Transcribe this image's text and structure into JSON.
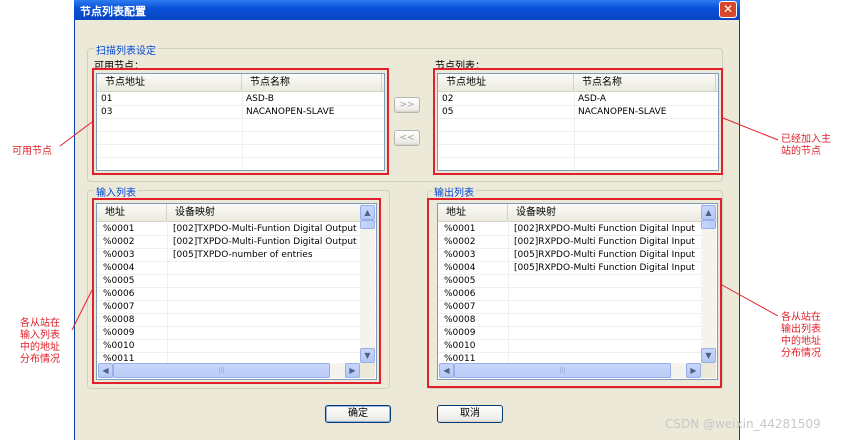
{
  "window": {
    "title": "节点列表配置",
    "close_symbol": "✕"
  },
  "scan_group": {
    "label": "扫描列表设定",
    "available": {
      "label": "可用节点：",
      "columns": [
        "节点地址",
        "节点名称"
      ],
      "rows": [
        {
          "addr": "01",
          "name": "ASD-B"
        },
        {
          "addr": "03",
          "name": "NACANOPEN-SLAVE"
        },
        {
          "addr": "",
          "name": ""
        },
        {
          "addr": "",
          "name": ""
        },
        {
          "addr": "",
          "name": ""
        },
        {
          "addr": "",
          "name": ""
        }
      ]
    },
    "scanlist": {
      "label": "节点列表：",
      "columns": [
        "节点地址",
        "节点名称"
      ],
      "rows": [
        {
          "addr": "02",
          "name": "ASD-A"
        },
        {
          "addr": "05",
          "name": "NACANOPEN-SLAVE"
        },
        {
          "addr": "",
          "name": ""
        },
        {
          "addr": "",
          "name": ""
        },
        {
          "addr": "",
          "name": ""
        },
        {
          "addr": "",
          "name": ""
        }
      ]
    },
    "add_button": ">>",
    "remove_button": "<<"
  },
  "input_group": {
    "label": "输入列表",
    "columns": [
      "地址",
      "设备映射"
    ],
    "rows": [
      {
        "addr": "%0001",
        "map": "[002]TXPDO-Multi-Funtion Digital Output"
      },
      {
        "addr": "%0002",
        "map": "[002]TXPDO-Multi-Funtion Digital Output"
      },
      {
        "addr": "%0003",
        "map": "[005]TXPDO-number of entries"
      },
      {
        "addr": "%0004",
        "map": ""
      },
      {
        "addr": "%0005",
        "map": ""
      },
      {
        "addr": "%0006",
        "map": ""
      },
      {
        "addr": "%0007",
        "map": ""
      },
      {
        "addr": "%0008",
        "map": ""
      },
      {
        "addr": "%0009",
        "map": ""
      },
      {
        "addr": "%0010",
        "map": ""
      },
      {
        "addr": "%0011",
        "map": ""
      }
    ]
  },
  "output_group": {
    "label": "输出列表",
    "columns": [
      "地址",
      "设备映射"
    ],
    "rows": [
      {
        "addr": "%0001",
        "map": "[002]RXPDO-Multi Function Digital Input"
      },
      {
        "addr": "%0002",
        "map": "[002]RXPDO-Multi Function Digital Input"
      },
      {
        "addr": "%0003",
        "map": "[005]RXPDO-Multi Function Digital Input"
      },
      {
        "addr": "%0004",
        "map": "[005]RXPDO-Multi Function Digital Input"
      },
      {
        "addr": "%0005",
        "map": ""
      },
      {
        "addr": "%0006",
        "map": ""
      },
      {
        "addr": "%0007",
        "map": ""
      },
      {
        "addr": "%0008",
        "map": ""
      },
      {
        "addr": "%0009",
        "map": ""
      },
      {
        "addr": "%0010",
        "map": ""
      },
      {
        "addr": "%0011",
        "map": ""
      }
    ]
  },
  "buttons": {
    "ok": "确定",
    "cancel": "取消"
  },
  "scroll_glyphs": {
    "up": "▲",
    "down": "▼",
    "left": "◀",
    "right": "▶",
    "grip": "|||"
  },
  "annotations": {
    "available_nodes": "可用节点",
    "added_master": [
      "已经加入主",
      "站的节点"
    ],
    "input_distribution": [
      "各从站在",
      "输入列表",
      "中的地址",
      "分布情况"
    ],
    "output_distribution": [
      "各从站在",
      "输出列表",
      "中的地址",
      "分布情况"
    ]
  },
  "watermark": "CSDN @weixin_44281509",
  "colors": {
    "title_bar": "#0a52d8",
    "dialog_bg": "#ece9d8",
    "group_label": "#0046d5",
    "annotation_red": "#e0202a"
  }
}
